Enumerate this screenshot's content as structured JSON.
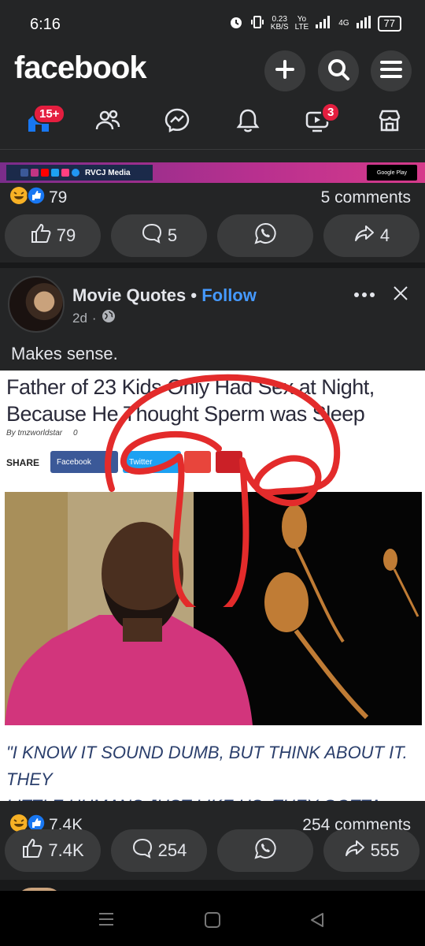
{
  "status": {
    "time": "6:16",
    "speed_value": "0.23",
    "speed_unit": "KB/S",
    "volte_top": "Yo",
    "volte_bottom": "LTE",
    "net": "4G",
    "battery": "77"
  },
  "header": {
    "logo": "facebook",
    "add_icon": "plus-icon",
    "search_icon": "search-icon",
    "menu_icon": "menu-icon"
  },
  "nav": {
    "home_badge": "15+",
    "video_badge": "3"
  },
  "prev_post": {
    "banner_text": "RVCJ Media",
    "banner_store": "Google Play",
    "reaction_count": "79",
    "comments": "5 comments",
    "actions": {
      "like": "79",
      "comment": "5",
      "share": "4"
    }
  },
  "post": {
    "author": "Movie Quotes",
    "separator": "•",
    "follow": "Follow",
    "time": "2d",
    "dot": "·",
    "text": "Makes sense.",
    "meme": {
      "headline_1": "Father of 23 Kids Only Had Sex at Night,",
      "headline_2": "Because He Thought Sperm was Sleep",
      "byline": "By tmzworldstar",
      "byline_count": "0",
      "share_label": "SHARE",
      "facebook_btn": "Facebook",
      "twitter_btn": "Twitter",
      "caption_1": "\"I KNOW IT SOUND DUMB, BUT THINK ABOUT IT. THEY",
      "caption_2": "LITTLE HUMANS JUST LIKE US. THEY GOTTA SLEEP\""
    },
    "reaction_count": "7.4K",
    "comments": "254 comments",
    "actions": {
      "like": "7.4K",
      "comment": "254",
      "share": "555"
    }
  },
  "colors": {
    "bg": "#18191a",
    "card": "#242526",
    "button": "#3a3b3c",
    "accent": "#4599ff",
    "badge": "#e41e3f"
  }
}
